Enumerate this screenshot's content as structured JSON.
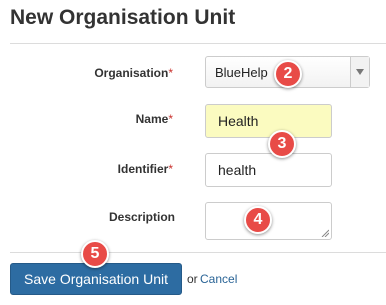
{
  "page": {
    "title": "New Organisation Unit"
  },
  "form": {
    "organisation": {
      "label": "Organisation",
      "required_mark": "*",
      "selected_value": "BlueHelp",
      "arrow_icon": "dropdown-arrow-icon"
    },
    "name": {
      "label": "Name",
      "required_mark": "*",
      "value": "Health",
      "highlight_color": "#fbfbc0"
    },
    "identifier": {
      "label": "Identifier",
      "required_mark": "*",
      "value": "health"
    },
    "description": {
      "label": "Description",
      "value": ""
    }
  },
  "actions": {
    "save_label": "Save Organisation Unit",
    "or_text": "or",
    "cancel_label": "Cancel"
  },
  "annotations": [
    "2",
    "3",
    "4",
    "5"
  ],
  "colors": {
    "primary_button": "#2d6ca2",
    "link": "#2a6496",
    "required": "#c9302c",
    "annotation_badge": "#e84b47"
  }
}
